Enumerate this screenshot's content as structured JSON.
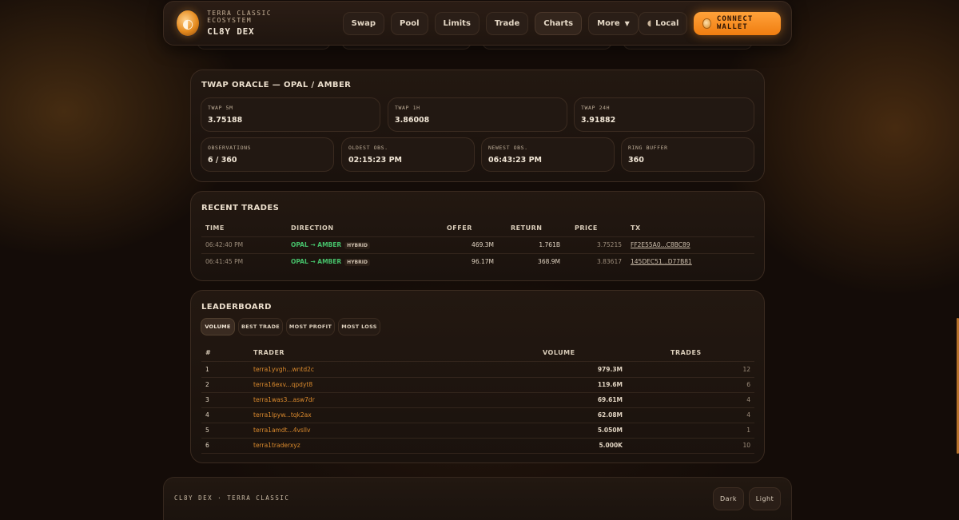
{
  "header": {
    "subtitle": "TERRA CLASSIC ECOSYSTEM",
    "title": "CL8Y DEX",
    "nav": [
      {
        "label": "Swap"
      },
      {
        "label": "Pool"
      },
      {
        "label": "Limits"
      },
      {
        "label": "Trade"
      },
      {
        "label": "Charts",
        "active": true
      },
      {
        "label": "More"
      }
    ],
    "network_label": "Local",
    "connect_label": "CONNECT WALLET"
  },
  "twap": {
    "title": "TWAP ORACLE — OPAL / AMBER",
    "stats_top": [
      {
        "label": "TWAP 5M",
        "value": "3.75188"
      },
      {
        "label": "TWAP 1H",
        "value": "3.86008"
      },
      {
        "label": "TWAP 24H",
        "value": "3.91882"
      }
    ],
    "stats_bottom": [
      {
        "label": "OBSERVATIONS",
        "value": "6 / 360"
      },
      {
        "label": "OLDEST OBS.",
        "value": "02:15:23 PM"
      },
      {
        "label": "NEWEST OBS.",
        "value": "06:43:23 PM"
      },
      {
        "label": "RING BUFFER",
        "value": "360"
      }
    ]
  },
  "recent_trades": {
    "title": "RECENT TRADES",
    "columns": {
      "time": "TIME",
      "direction": "DIRECTION",
      "offer": "OFFER",
      "return": "RETURN",
      "price": "PRICE",
      "tx": "TX"
    },
    "rows": [
      {
        "time": "06:42:40 PM",
        "direction": "OPAL → AMBER",
        "tag": "HYBRID",
        "offer": "469.3M",
        "return": "1.761B",
        "price": "3.75215",
        "tx": "FF2E55A0...C8BC89"
      },
      {
        "time": "06:41:45 PM",
        "direction": "OPAL → AMBER",
        "tag": "HYBRID",
        "offer": "96.17M",
        "return": "368.9M",
        "price": "3.83617",
        "tx": "145DEC51...D77B81"
      }
    ]
  },
  "leaderboard": {
    "title": "LEADERBOARD",
    "tabs": [
      {
        "label": "VOLUME",
        "active": true
      },
      {
        "label": "BEST TRADE"
      },
      {
        "label": "MOST PROFIT"
      },
      {
        "label": "MOST LOSS"
      }
    ],
    "columns": {
      "rank": "#",
      "trader": "TRADER",
      "volume": "VOLUME",
      "trades": "TRADES"
    },
    "rows": [
      {
        "rank": "1",
        "trader": "terra1yvgh...wntd2c",
        "volume": "979.3M",
        "trades": "12"
      },
      {
        "rank": "2",
        "trader": "terra16exv...qpdyt8",
        "volume": "119.6M",
        "trades": "6"
      },
      {
        "rank": "3",
        "trader": "terra1was3...asw7dr",
        "volume": "69.61M",
        "trades": "4"
      },
      {
        "rank": "4",
        "trader": "terra1lpyw...tqk2ax",
        "volume": "62.08M",
        "trades": "4"
      },
      {
        "rank": "5",
        "trader": "terra1amdt...4vsllv",
        "volume": "5.050M",
        "trades": "1"
      },
      {
        "rank": "6",
        "trader": "terra1traderxyz",
        "volume": "5.000K",
        "trades": "10"
      }
    ]
  },
  "footer": {
    "text": "CL8Y DEX · TERRA CLASSIC",
    "dark_label": "Dark",
    "light_label": "Light"
  },
  "colors": {
    "accent": "#f07d10",
    "trader_link": "#d9892d",
    "positive": "#46c06a",
    "background": "#140c08"
  }
}
